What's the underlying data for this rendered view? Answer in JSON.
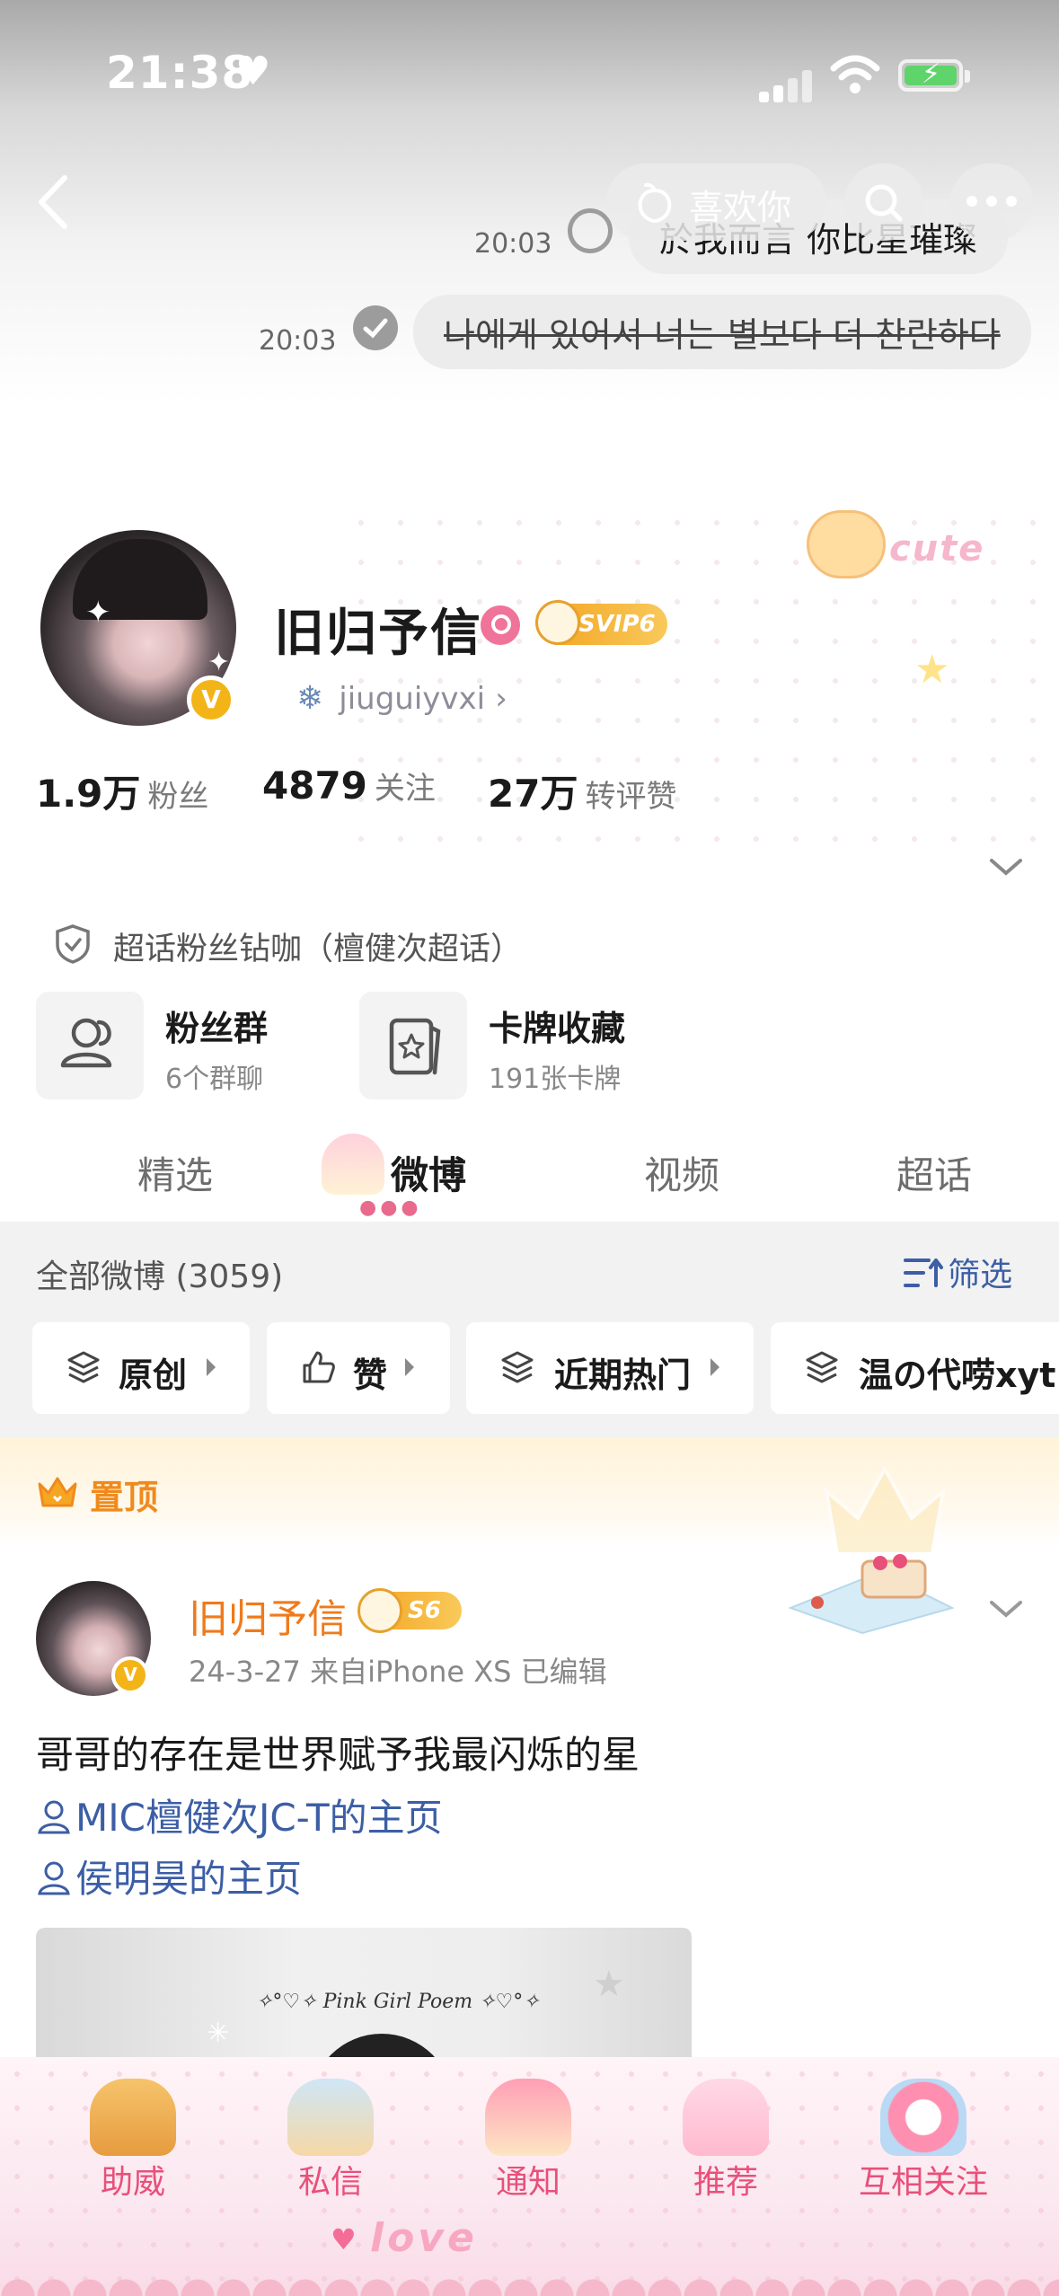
{
  "status_bar": {
    "time": "21:38",
    "heart": "♥",
    "icons": [
      "cellular-signal-icon",
      "wifi-icon",
      "battery-charging-icon"
    ],
    "battery_color": "#5fd46a"
  },
  "header": {
    "back_icon": "chevron-left-icon",
    "like_label": "喜欢你",
    "search_icon": "search-icon",
    "more_icon": "more-dots-icon",
    "chat": [
      {
        "time": "20:03",
        "text": "於我而言 你比星璀璨"
      },
      {
        "time": "20:03",
        "text": "나에게 있어서 너는 별보다 더 찬란하다"
      }
    ]
  },
  "profile": {
    "name": "旧归予信",
    "verify_mark": "V",
    "svip_badge": "SVIP6",
    "handle": "jiuguiyvxi",
    "handle_chevron": "›",
    "snow_icon": "❄",
    "stats": [
      {
        "value": "1.9万",
        "label": "粉丝"
      },
      {
        "value": "4879",
        "label": "关注"
      },
      {
        "value": "27万",
        "label": "转评赞"
      }
    ],
    "super_topic": "超话粉丝钻咖（檀健次超话）",
    "tiles": [
      {
        "title": "粉丝群",
        "sub": "6个群聊",
        "icon": "group-icon"
      },
      {
        "title": "卡牌收藏",
        "sub": "191张卡牌",
        "icon": "card-collection-icon"
      }
    ],
    "deco_cute": "cute"
  },
  "tabs": [
    {
      "label": "精选",
      "active": false
    },
    {
      "label": "微博",
      "active": true
    },
    {
      "label": "视频",
      "active": false
    },
    {
      "label": "超话",
      "active": false
    }
  ],
  "feed": {
    "count_label": "全部微博 (3059)",
    "filter_label": "筛选",
    "chips": [
      {
        "label": "原创"
      },
      {
        "label": "赞"
      },
      {
        "label": "近期热门"
      },
      {
        "label": "温の代唠xyt"
      }
    ]
  },
  "pinned": {
    "label": "置顶",
    "author": "旧归予信",
    "level_badge": "S6",
    "meta": "24-3-27  来自iPhone XS  已编辑",
    "text": "哥哥的存在是世界赋予我最闪烁的星",
    "mentions": [
      "MIC檀健次JC-T的主页",
      "侯明昊的主页"
    ],
    "image_caption": "✧°♡✧ Pink Girl Poem ✧♡°✧"
  },
  "bottom_nav": {
    "items": [
      "助威",
      "私信",
      "通知",
      "推荐",
      "互相关注"
    ],
    "love_text": "love",
    "accent_color": "#e8507a"
  }
}
